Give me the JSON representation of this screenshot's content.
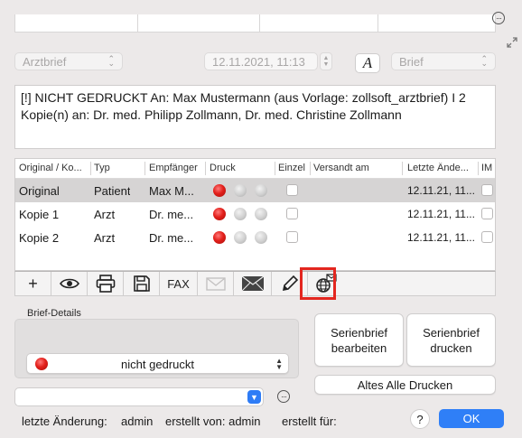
{
  "top": {
    "letter_type": "Arztbrief",
    "datetime": "12.11.2021, 11:13",
    "font_button": "A",
    "doc_type": "Brief"
  },
  "message_text": "[!] NICHT GEDRUCKT An:  Max Mustermann (aus Vorlage: zollsoft_arztbrief) I 2 Kopie(n) an: Dr. med. Philipp Zollmann, Dr. med. Christine Zollmann",
  "table": {
    "headers": [
      "Original / Ko...",
      "Typ",
      "Empfänger",
      "Druck",
      "Einzel",
      "Versandt am",
      "Letzte Ände...",
      "IM"
    ],
    "rows": [
      {
        "name": "Original",
        "type": "Patient",
        "recipient": "Max M...",
        "print_status": [
          "red",
          "grey",
          "grey"
        ],
        "changed": "12.11.21, 11..."
      },
      {
        "name": "Kopie 1",
        "type": "Arzt",
        "recipient": "Dr. me...",
        "print_status": [
          "red",
          "grey",
          "grey"
        ],
        "changed": "12.11.21, 11..."
      },
      {
        "name": "Kopie 2",
        "type": "Arzt",
        "recipient": "Dr. me...",
        "print_status": [
          "red",
          "grey",
          "grey"
        ],
        "changed": "12.11.21, 11..."
      }
    ]
  },
  "toolbar": {
    "add": "+",
    "fax": "FAX"
  },
  "details": {
    "section_label": "Brief-Details",
    "status": "nicht gedruckt",
    "status_color": "#e3201b"
  },
  "buttons": {
    "serial_edit": "Serienbrief bearbeiten",
    "serial_print": "Serienbrief drucken",
    "print_all_old": "Altes Alle Drucken",
    "help": "?",
    "ok": "OK"
  },
  "footer": {
    "last_change_label": "letzte Änderung:",
    "last_change_value": "admin",
    "created_by": "erstellt von: admin",
    "created_for": "erstellt für:"
  },
  "colors": {
    "accent": "#2f7ff7",
    "highlight": "#e3261f",
    "selected_row": "#d6d4d4"
  }
}
